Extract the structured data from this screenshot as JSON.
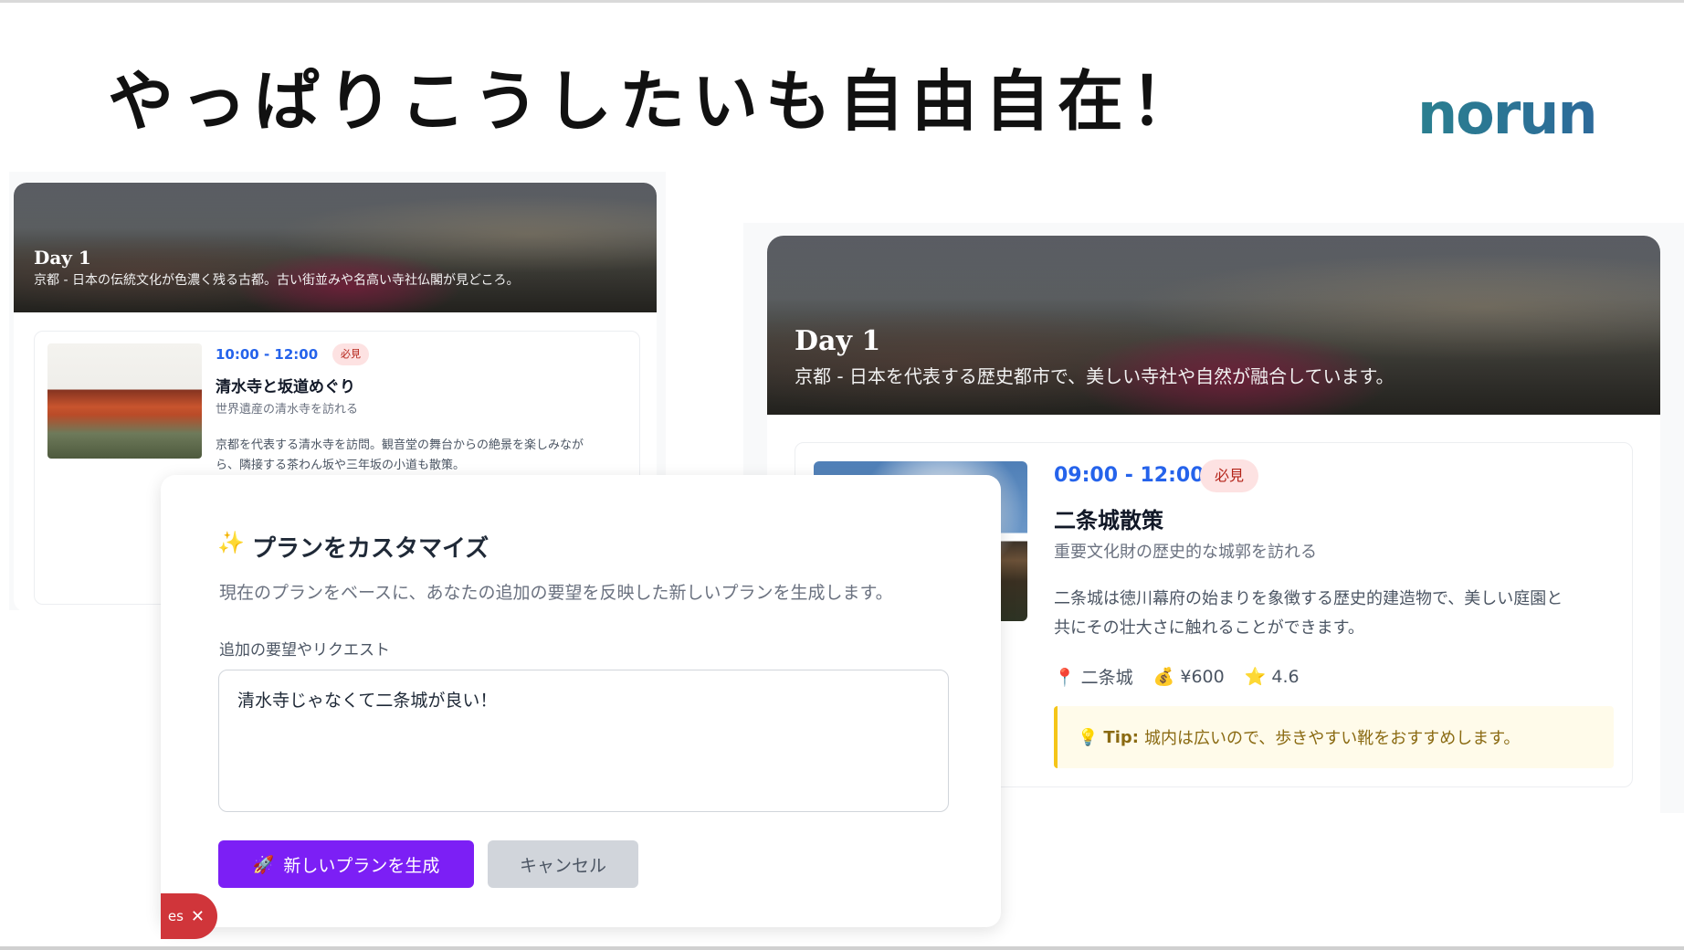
{
  "slide": {
    "title": "やっぱりこうしたいも自由自在！",
    "logo": "norun"
  },
  "left_card": {
    "day_title": "Day 1",
    "day_desc": "京都 - 日本の伝統文化が色濃く残る古都。古い街並みや名高い寺社仏閣が見どころ。",
    "activity": {
      "time": "10:00 - 12:00",
      "badge": "必見",
      "name": "清水寺と坂道めぐり",
      "subtitle": "世界遺産の清水寺を訪れる",
      "desc_line1": "京都を代表する清水寺を訪問。観音堂の舞台からの絶景を楽しみなが",
      "desc_line2": "ら、隣接する茶わん坂や三年坂の小道も散策。"
    }
  },
  "modal": {
    "title": "プランをカスタマイズ",
    "description": "現在のプランをベースに、あなたの追加の要望を反映した新しいプランを生成します。",
    "field_label": "追加の要望やリクエスト",
    "field_value": "清水寺じゃなくて二条城が良い！",
    "primary_button": "新しいプランを生成",
    "secondary_button": "キャンセル"
  },
  "toast": {
    "text": "es"
  },
  "right_card": {
    "day_title": "Day 1",
    "day_desc": "京都 - 日本を代表する歴史都市で、美しい寺社や自然が融合しています。",
    "activity": {
      "time": "09:00 - 12:00",
      "badge": "必見",
      "name": "二条城散策",
      "subtitle": "重要文化財の歴史的な城郭を訪れる",
      "desc_line1": "二条城は徳川幕府の始まりを象徴する歴史的建造物で、美しい庭園と",
      "desc_line2": "共にその壮大さに触れることができます。",
      "location": "二条城",
      "price": "¥600",
      "rating": "4.6",
      "tip_label": "Tip:",
      "tip_text": "城内は広いので、歩きやすい靴をおすすめします。"
    }
  },
  "icons": {
    "sparkle": "sparkles-icon",
    "rocket": "rocket-icon",
    "close": "close-icon",
    "pin": "pin-icon",
    "money": "money-bag-icon",
    "star": "star-icon",
    "bulb": "lightbulb-icon"
  },
  "colors": {
    "time_blue": "#2563eb",
    "primary_purple": "#7c1ff5",
    "badge_bg": "#fde2e2",
    "badge_text": "#b42318",
    "toast_red": "#d0353a",
    "tip_border": "#f5c518"
  }
}
